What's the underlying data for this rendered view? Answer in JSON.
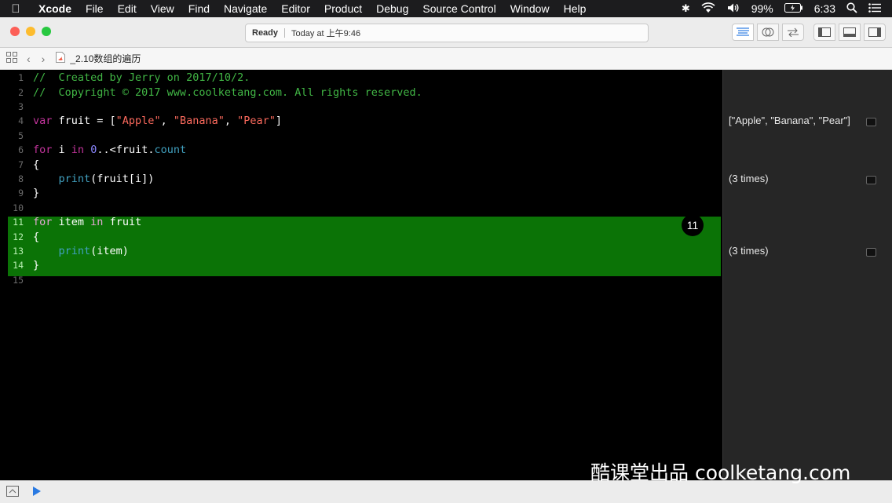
{
  "menubar": {
    "apple": "",
    "app": "Xcode",
    "items": [
      "File",
      "Edit",
      "View",
      "Find",
      "Navigate",
      "Editor",
      "Product",
      "Debug",
      "Source Control",
      "Window",
      "Help"
    ],
    "battery": "99%",
    "time": "6:33"
  },
  "toolbar": {
    "status": "Ready",
    "status_detail": "Today at 上午9:46"
  },
  "jumpbar": {
    "filename": "_2.10数组的遍历"
  },
  "editor": {
    "lines": [
      {
        "n": "1",
        "segs": [
          {
            "t": "//  Created by Jerry on 2017/10/2.",
            "c": "cm"
          }
        ]
      },
      {
        "n": "2",
        "segs": [
          {
            "t": "//  Copyright © 2017 www.coolketang.com. All rights reserved.",
            "c": "cm"
          }
        ]
      },
      {
        "n": "3",
        "segs": []
      },
      {
        "n": "4",
        "segs": [
          {
            "t": "var",
            "c": "kw"
          },
          {
            "t": " fruit = [",
            "c": "var"
          },
          {
            "t": "\"Apple\"",
            "c": "str"
          },
          {
            "t": ", ",
            "c": "var"
          },
          {
            "t": "\"Banana\"",
            "c": "str"
          },
          {
            "t": ", ",
            "c": "var"
          },
          {
            "t": "\"Pear\"",
            "c": "str"
          },
          {
            "t": "]",
            "c": "var"
          }
        ]
      },
      {
        "n": "5",
        "segs": []
      },
      {
        "n": "6",
        "segs": [
          {
            "t": "for",
            "c": "kw"
          },
          {
            "t": " i ",
            "c": "var"
          },
          {
            "t": "in",
            "c": "kw"
          },
          {
            "t": " ",
            "c": "var"
          },
          {
            "t": "0",
            "c": "num"
          },
          {
            "t": "..<fruit.",
            "c": "var"
          },
          {
            "t": "count",
            "c": "fn"
          }
        ]
      },
      {
        "n": "7",
        "segs": [
          {
            "t": "{",
            "c": "var"
          }
        ]
      },
      {
        "n": "8",
        "segs": [
          {
            "t": "    ",
            "c": "var"
          },
          {
            "t": "print",
            "c": "fn"
          },
          {
            "t": "(fruit[i])",
            "c": "var"
          }
        ]
      },
      {
        "n": "9",
        "segs": [
          {
            "t": "}",
            "c": "var"
          }
        ]
      },
      {
        "n": "10",
        "segs": []
      },
      {
        "n": "11",
        "segs": [
          {
            "t": "for",
            "c": "hkw"
          },
          {
            "t": " item ",
            "c": "var"
          },
          {
            "t": "in",
            "c": "hkw"
          },
          {
            "t": " fruit",
            "c": "var"
          }
        ]
      },
      {
        "n": "12",
        "segs": [
          {
            "t": "{",
            "c": "var"
          }
        ]
      },
      {
        "n": "13",
        "segs": [
          {
            "t": "    ",
            "c": "var"
          },
          {
            "t": "print",
            "c": "fn"
          },
          {
            "t": "(item)",
            "c": "var"
          }
        ]
      },
      {
        "n": "14",
        "segs": [
          {
            "t": "}",
            "c": "var"
          }
        ]
      },
      {
        "n": "15",
        "segs": []
      }
    ],
    "badge": "11"
  },
  "results": [
    {
      "line": "4",
      "text": "[\"Apple\", \"Banana\", \"Pear\"]"
    },
    {
      "line": "8",
      "text": "(3 times)"
    },
    {
      "line": "13",
      "text": "(3 times)"
    }
  ],
  "watermark": "酷课堂出品 coolketang.com",
  "colors": {
    "comment": "#41b645",
    "keyword": "#c2349b",
    "string": "#fc6a5d",
    "number": "#8b87ff",
    "function": "#41a1c0",
    "highlight": "#0b7306"
  }
}
